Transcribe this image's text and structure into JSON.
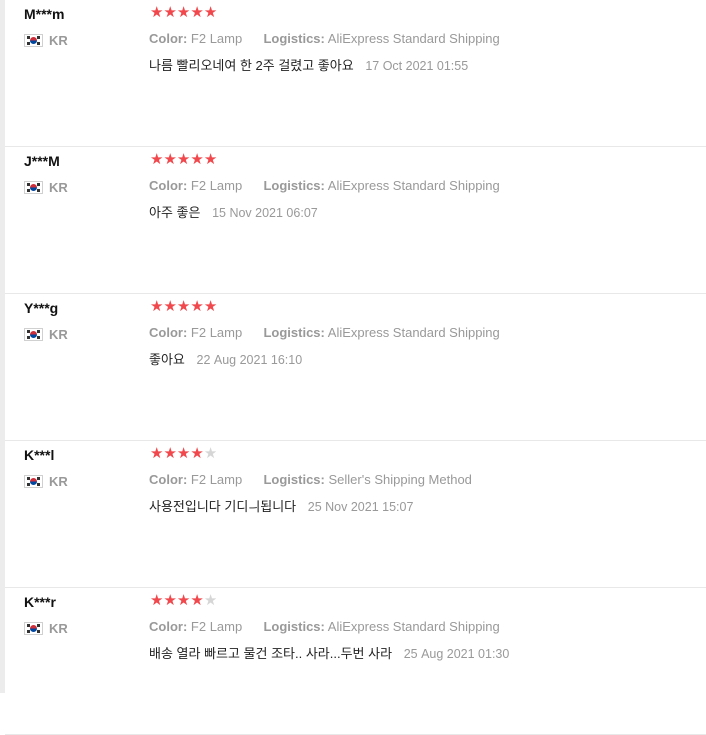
{
  "reviews": [
    {
      "name": "M***m",
      "country": "KR",
      "rating": 5,
      "color_label": "Color:",
      "color_value": "F2 Lamp",
      "logistics_label": "Logistics:",
      "logistics_value": "AliExpress Standard Shipping",
      "text": "나름 빨리오네여 한 2주 걸렸고 좋아요",
      "date": "17 Oct 2021 01:55"
    },
    {
      "name": "J***M",
      "country": "KR",
      "rating": 5,
      "color_label": "Color:",
      "color_value": "F2 Lamp",
      "logistics_label": "Logistics:",
      "logistics_value": "AliExpress Standard Shipping",
      "text": "아주 좋은",
      "date": "15 Nov 2021 06:07"
    },
    {
      "name": "Y***g",
      "country": "KR",
      "rating": 5,
      "color_label": "Color:",
      "color_value": "F2 Lamp",
      "logistics_label": "Logistics:",
      "logistics_value": "AliExpress Standard Shipping",
      "text": "좋아요",
      "date": "22 Aug 2021 16:10"
    },
    {
      "name": "K***l",
      "country": "KR",
      "rating": 4,
      "color_label": "Color:",
      "color_value": "F2 Lamp",
      "logistics_label": "Logistics:",
      "logistics_value": "Seller's Shipping Method",
      "text": "사용전입니다 기디ㅢ됩니다",
      "date": "25 Nov 2021 15:07"
    },
    {
      "name": "K***r",
      "country": "KR",
      "rating": 4,
      "color_label": "Color:",
      "color_value": "F2 Lamp",
      "logistics_label": "Logistics:",
      "logistics_value": "AliExpress Standard Shipping",
      "text": "배송 열라 빠르고 물건 조타.. 사라...두번 사라",
      "date": "25 Aug 2021 01:30"
    }
  ],
  "star_glyph": "★",
  "colors": {
    "star_on": "#f0484c",
    "star_off": "#d6d6d6",
    "muted": "#999999"
  },
  "flag_icon": "south-korea-flag-icon"
}
